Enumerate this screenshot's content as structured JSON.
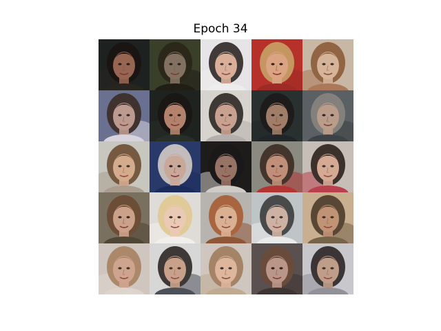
{
  "figure": {
    "title": "Epoch 34"
  },
  "grid": {
    "rows": 5,
    "cols": 5,
    "tiles": [
      {
        "bg": "#1d2220",
        "hair": "#1a1410",
        "skin": "#a8705a",
        "accent": "#2a2622"
      },
      {
        "bg": "#3a3f2a",
        "hair": "#2a2418",
        "skin": "#8c7868",
        "accent": "#1e1a14"
      },
      {
        "bg": "#e6e4e6",
        "hair": "#2a2422",
        "skin": "#d8a890",
        "accent": "#f0eeee"
      },
      {
        "bg": "#b8322c",
        "hair": "#c8a468",
        "skin": "#e0b490",
        "accent": "#9a2a24"
      },
      {
        "bg": "#c9b8a4",
        "hair": "#8a5a36",
        "skin": "#d8b498",
        "accent": "#a87050"
      },
      {
        "bg": "#6a7090",
        "hair": "#3a2a22",
        "skin": "#c8a090",
        "accent": "#e8e0e8"
      },
      {
        "bg": "#1e2420",
        "hair": "#1a1614",
        "skin": "#c89078",
        "accent": "#2a302a"
      },
      {
        "bg": "#d8d4d0",
        "hair": "#2a2420",
        "skin": "#c89a88",
        "accent": "#b0aaa8"
      },
      {
        "bg": "#2a3030",
        "hair": "#1c1a18",
        "skin": "#b08870",
        "accent": "#202426"
      },
      {
        "bg": "#5a6064",
        "hair": "#8a8680",
        "skin": "#c8a490",
        "accent": "#3a3e40"
      },
      {
        "bg": "#c8c8c0",
        "hair": "#6a4a30",
        "skin": "#d8a888",
        "accent": "#a89888"
      },
      {
        "bg": "#2a3a6a",
        "hair": "#d8d0c8",
        "skin": "#e0b8a0",
        "accent": "#1a2a5a"
      },
      {
        "bg": "#1e1c1c",
        "hair": "#1a1818",
        "skin": "#a88070",
        "accent": "#e8e4e0"
      },
      {
        "bg": "#8a8a80",
        "hair": "#3a2a20",
        "skin": "#c89078",
        "accent": "#b82a28"
      },
      {
        "bg": "#c8c0b8",
        "hair": "#2a1e18",
        "skin": "#d8a890",
        "accent": "#b83040"
      },
      {
        "bg": "#7a7060",
        "hair": "#6a4830",
        "skin": "#d8a890",
        "accent": "#4a4030"
      },
      {
        "bg": "#e0dcd8",
        "hair": "#e0c890",
        "skin": "#ecc8b0",
        "accent": "#f4f2f0"
      },
      {
        "bg": "#b8b4b0",
        "hair": "#a85a30",
        "skin": "#e0b090",
        "accent": "#8a4a28"
      },
      {
        "bg": "#c0c4c8",
        "hair": "#3a3a3a",
        "skin": "#d0b0a0",
        "accent": "#f0f0f0"
      },
      {
        "bg": "#c8b090",
        "hair": "#4a3a28",
        "skin": "#c09070",
        "accent": "#6a5a40"
      },
      {
        "bg": "#d0c8c0",
        "hair": "#a88060",
        "skin": "#d0a088",
        "accent": "#e0d8d0"
      },
      {
        "bg": "#d8d8d8",
        "hair": "#2a2420",
        "skin": "#c89a80",
        "accent": "#3a3e48"
      },
      {
        "bg": "#d0c8c0",
        "hair": "#a07a5a",
        "skin": "#e0b498",
        "accent": "#bfa88c"
      },
      {
        "bg": "#5a5050",
        "hair": "#6a4a38",
        "skin": "#c8a090",
        "accent": "#3a3030"
      },
      {
        "bg": "#c8c8cc",
        "hair": "#2a2220",
        "skin": "#c09880",
        "accent": "#8a8a90"
      }
    ]
  }
}
